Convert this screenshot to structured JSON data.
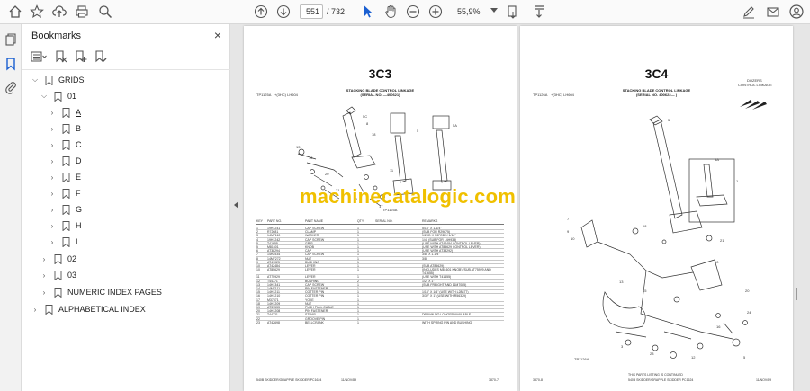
{
  "toolbar": {
    "current_page": "551",
    "total_pages": "/ 732",
    "zoom": "55,9%"
  },
  "panel": {
    "title": "Bookmarks"
  },
  "bookmarks": {
    "grids": "GRIDS",
    "g01": "01",
    "sub": [
      "A",
      "B",
      "C",
      "D",
      "E",
      "F",
      "G",
      "H",
      "I"
    ],
    "g02": "02",
    "g03": "03",
    "numeric": "NUMERIC INDEX PAGES",
    "alpha": "ALPHABETICAL INDEX"
  },
  "left_page": {
    "page_label": "3C3",
    "header_center_1": "STACKING BLADE CONTROL LINKAGE",
    "header_center_2": "(SERIAL NO. —400621)",
    "top_left": "TP1125A",
    "top_left_2": "+(3HC) LH604",
    "table_head": [
      "KEY",
      "PART NO.",
      "PART NAME",
      "QTY",
      "SERIAL NO.",
      "REMARKS"
    ],
    "rows": [
      [
        "1",
        "19H1241",
        "CAP SCREW",
        "1",
        "",
        "5/16\" X 1-1/4\""
      ],
      [
        "2",
        "R72681",
        "CLAMP",
        "1",
        "",
        "(SUB FOR R29675)"
      ],
      [
        "3",
        "14M7110",
        "WASHER",
        "1",
        "",
        "1/2\"ID X 7/8\"OD X 1/16\""
      ],
      [
        "4",
        "19H1242",
        "CAP SCREW",
        "1",
        "",
        "1/4\" (SUB FOR 14H933)"
      ],
      [
        "5",
        "T41655",
        "GRIP",
        "1",
        "",
        "(USE WITH AT42484 CONTROL LEVER)"
      ],
      [
        "5",
        "M81601",
        "KNOB",
        "1",
        "",
        "(USE WITH AT85629 CONTROL LEVER)"
      ],
      [
        "6",
        "AT38294",
        "CAP",
        "1",
        "",
        "(USE WITH AT38292)"
      ],
      [
        "7",
        "14H2534",
        "CAP SCREW",
        "1",
        "",
        "3/8\" X 1-1/4\""
      ],
      [
        "8",
        "14M7272",
        "NUT",
        "1",
        "",
        "3/8\""
      ],
      [
        "9",
        "AT41025",
        "BUSHING",
        "1",
        "",
        ""
      ],
      [
        "10",
        "AT42484",
        "LEVER",
        "1",
        "",
        "(SUB AT85629)"
      ],
      [
        "10",
        "AT85629",
        "LEVER",
        "1",
        "",
        "(INCLUDES M81601 KNOB) (SUB AT75929 AND"
      ],
      [
        "",
        "",
        "",
        "",
        "",
        "T41655)"
      ],
      [
        "11",
        "AT75929",
        "LEVER",
        "1",
        "",
        "(USE WITH T41655)"
      ],
      [
        "12",
        "T44771",
        "BUSHING",
        "2",
        "",
        "1/2\" X 1\""
      ],
      [
        "13",
        "14H1341",
        "CAP SCREW",
        "1",
        "",
        "(SUB FREIGHT AND 11M7085)"
      ],
      [
        "14",
        "14M7111",
        "PIN FASTENER",
        "1",
        "",
        ""
      ],
      [
        "15",
        "14H1211",
        "COTTER PIN",
        "1",
        "",
        "1/16\" X 1/4\" (USE WITH L28877)"
      ],
      [
        "16",
        "14H1210",
        "COTTER PIN",
        "1",
        "",
        "3/32\" X 1\" (USE WITH R56329)"
      ],
      [
        "17",
        "M37871",
        "YOKE",
        "1",
        "",
        ""
      ],
      [
        "18",
        "14H1209",
        "NUT",
        "1",
        "",
        ""
      ],
      [
        "19",
        "AT37533",
        "PUSH PULL CABLE",
        "1",
        "",
        ""
      ],
      [
        "20",
        "14H1208",
        "PIN FASTENER",
        "1",
        "",
        ""
      ],
      [
        "21",
        "T44721",
        "STRAP",
        "1",
        "",
        "DRAWN NO LONGER AVAILABLE"
      ],
      [
        "22",
        "",
        "GROOVE PIN",
        "1",
        "",
        ""
      ],
      [
        "23",
        "AT42698",
        "BELLCRANK",
        "1",
        "",
        "WITH SPRING PIN AND BUSHING"
      ]
    ],
    "footer_left": "540B SKIDDER/GRAPPLE SKIDDER PC1624",
    "footer_mid": "11/NOV/89",
    "footer_right": "3870-7"
  },
  "right_page": {
    "page_label": "3C4",
    "header_right_1": "DOZERS",
    "header_right_2": "CONTROL LINKAGE",
    "header_center_1": "STACKING BLADE CONTROL LINKAGE",
    "header_center_2": "(SERIAL NO. 400622—         )",
    "top_left": "TP1126A",
    "top_left_2": "+(3HC) LH604",
    "footer_left": "3870-8",
    "footer_mid": "THIS PARTS LISTING IS CONTINUED",
    "footer_left_2": "540B SKIDDER/GRAPPLE SKIDDER PC1624",
    "footer_right": "11/NOV/89"
  },
  "watermark": "machinecatalogic.com"
}
